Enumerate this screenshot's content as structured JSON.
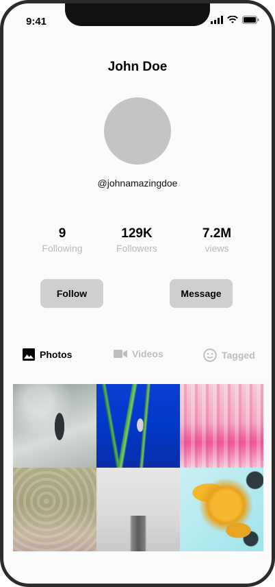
{
  "status_bar": {
    "time": "9:41"
  },
  "profile": {
    "name": "John Doe",
    "handle": "@johnamazingdoe"
  },
  "stats": [
    {
      "value": "9",
      "label": "Following"
    },
    {
      "value": "129K",
      "label": "Followers"
    },
    {
      "value": "7.2M",
      "label": "views"
    }
  ],
  "actions": {
    "follow_label": "Follow",
    "message_label": "Message"
  },
  "tabs": [
    {
      "label": "Photos",
      "icon": "image-icon",
      "active": true
    },
    {
      "label": "Videos",
      "icon": "video-camera-icon",
      "active": false
    },
    {
      "label": "Tagged",
      "icon": "smiley-icon",
      "active": false
    }
  ],
  "colors": {
    "button_bg": "#cfcfcf",
    "avatar_placeholder": "#c4c4c4",
    "muted_text": "#b9b9b9"
  }
}
